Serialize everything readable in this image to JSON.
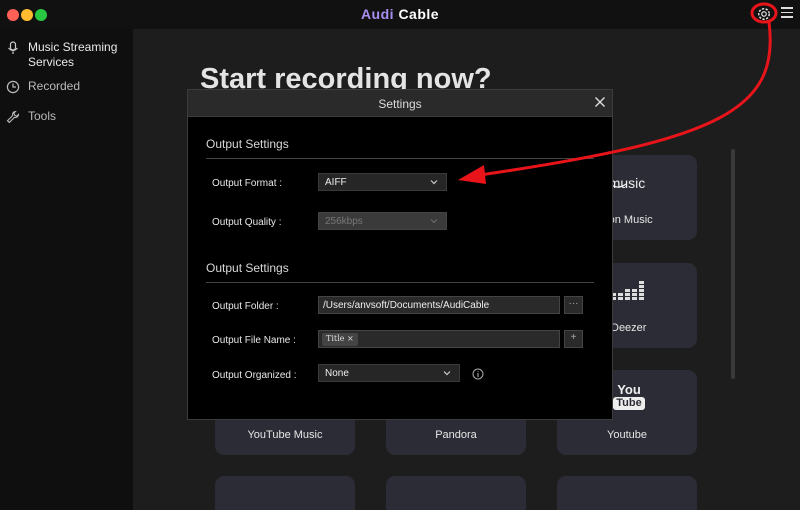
{
  "app": {
    "title_accent": "Aud",
    "title_mid": "i",
    "title_rest": "Cable"
  },
  "sidebar": {
    "items": [
      {
        "label": "Music Streaming Services",
        "icon": "microphone-icon"
      },
      {
        "label": "Recorded",
        "icon": "clock-icon"
      },
      {
        "label": "Tools",
        "icon": "wrench-icon"
      }
    ]
  },
  "main": {
    "headline": "Start recording now?",
    "tiles": [
      {
        "label": "Amazon Music",
        "visible_label": "azon Music",
        "logo_text": "music"
      },
      {
        "label": "Deezer",
        "visible_label": "Deezer"
      },
      {
        "label": "YouTube Music",
        "visible_label": "YouTube Music"
      },
      {
        "label": "Pandora",
        "visible_label": "Pandora"
      },
      {
        "label": "Youtube",
        "visible_label": "Youtube",
        "logo_top": "You",
        "logo_bottom": "Tube"
      }
    ]
  },
  "settings": {
    "title": "Settings",
    "section1": "Output Settings",
    "format_label": "Output Format :",
    "format_value": "AIFF",
    "quality_label": "Output Quality :",
    "quality_value": "256kbps",
    "section2": "Output Settings",
    "folder_label": "Output Folder :",
    "folder_value": "/Users/anvsoft/Documents/AudiCable",
    "folder_browse": "···",
    "filename_label": "Output File Name :",
    "filename_tag": "Title",
    "filename_tag_remove": "×",
    "filename_add": "+",
    "organized_label": "Output Organized :",
    "organized_value": "None"
  },
  "colors": {
    "accent": "#a88ef0",
    "annotation": "#e8141a",
    "tile": "#2c2c36"
  }
}
